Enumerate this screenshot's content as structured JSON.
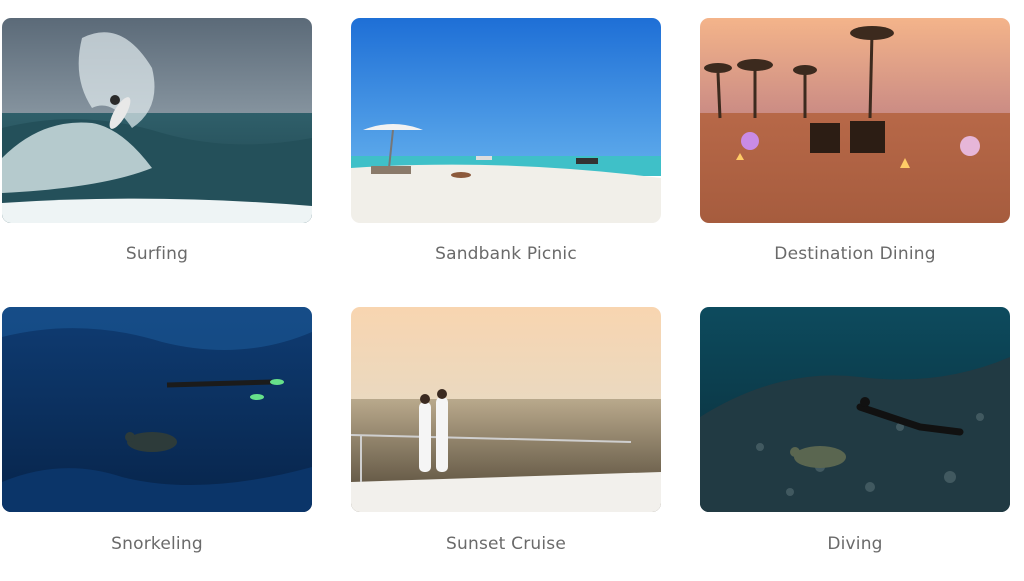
{
  "activities": [
    {
      "label": "Surfing"
    },
    {
      "label": "Sandbank Picnic"
    },
    {
      "label": "Destination Dining"
    },
    {
      "label": "Snorkeling"
    },
    {
      "label": "Sunset Cruise"
    },
    {
      "label": "Diving"
    }
  ],
  "colors": {
    "caption": "#6a6a6a",
    "background": "#ffffff"
  }
}
